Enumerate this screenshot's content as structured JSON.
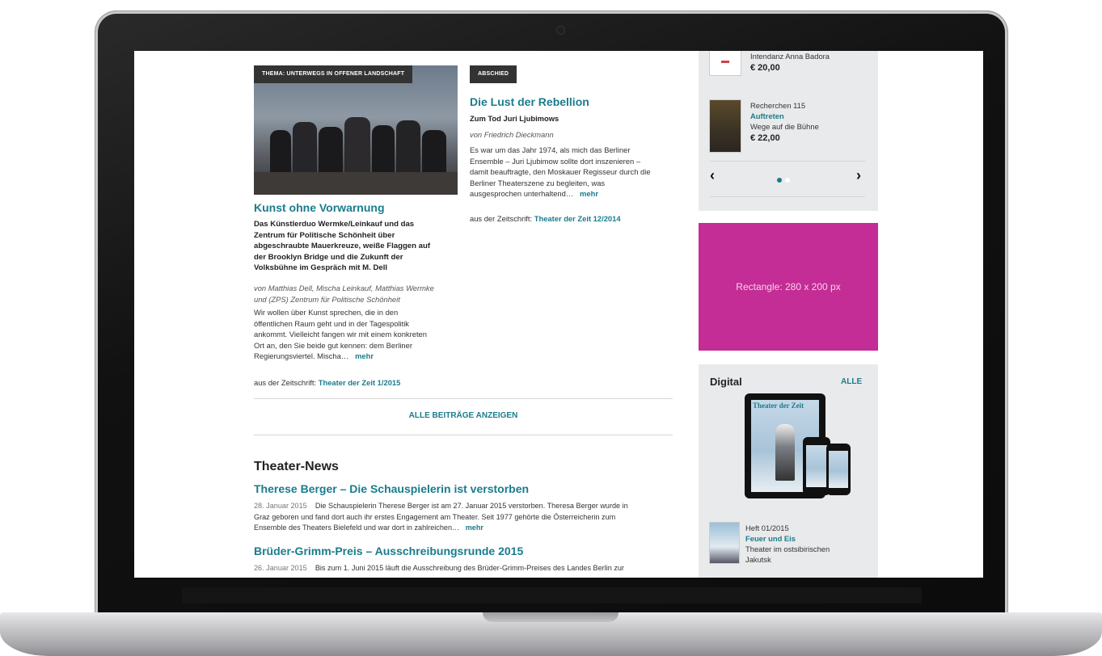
{
  "articles": [
    {
      "tag": "THEMA: UNTERWEGS IN OFFENER LANDSCHAFT",
      "title": "Kunst ohne Vorwarnung",
      "subtitle_lines": [
        "Das Künstlerduo Wermke/Leinkauf und das",
        "Zentrum für Politische Schönheit über",
        "abgeschraubte Mauerkreuze, weiße Flaggen auf",
        "der Brooklyn Bridge und die Zukunft der",
        "Volksbühne im Gespräch mit M. Dell"
      ],
      "author_lines": [
        "von Matthias Dell, Mischa Leinkauf, Matthias Wermke",
        "und (ZPS) Zentrum für Politische Schönheit"
      ],
      "body_lines": [
        "Wir wollen über Kunst sprechen, die in den",
        "öffentlichen Raum geht und in der Tagespolitik",
        "ankommt. Vielleicht fangen wir mit einem konkreten",
        "Ort an, den Sie beide gut kennen: dem Berliner",
        "Regierungsviertel. Mischa…"
      ],
      "more": "mehr",
      "source_prefix": "aus der Zeitschrift:",
      "source": "Theater der Zeit 1/2015"
    },
    {
      "tag": "ABSCHIED",
      "title": "Die Lust der Rebellion",
      "subtitle": "Zum Tod Juri Ljubimows",
      "author": "von Friedrich Dieckmann",
      "body_lines": [
        "Es war um das Jahr 1974, als mich das Berliner",
        "Ensemble – Juri Ljubimow sollte dort inszenieren –",
        "damit beauftragte, den Moskauer Regisseur durch die",
        "Berliner Theaterszene zu begleiten, was",
        "ausgesprochen unterhaltend…"
      ],
      "more": "mehr",
      "source_prefix": "aus der Zeitschrift:",
      "source": "Theater der Zeit 12/2014"
    }
  ],
  "all_posts_label": "ALLE BEITRÄGE ANZEIGEN",
  "news": {
    "heading": "Theater-News",
    "items": [
      {
        "title": "Therese Berger – Die Schauspielerin ist verstorben",
        "date": "28. Januar 2015",
        "lines": [
          "Die Schauspielerin Therese Berger ist am 27. Januar 2015 verstorben. Theresa Berger wurde in",
          "Graz geboren und fand dort auch ihr erstes Engagement am Theater. Seit 1977 gehörte die Österreicherin zum",
          "Ensemble des Theaters Bielefeld und war dort in zahlreichen…"
        ],
        "more": "mehr"
      },
      {
        "title": "Brüder-Grimm-Preis – Ausschreibungsrunde 2015",
        "date": "26. Januar 2015",
        "lines": [
          "Bis zum 1. Juni 2015 läuft die Ausschreibung des Brüder-Grimm-Preises des Landes Berlin zur"
        ]
      }
    ]
  },
  "sidebar": {
    "book1": {
      "line1": "Intendanz Anna Badora",
      "price": "€ 20,00"
    },
    "book2": {
      "series": "Recherchen 115",
      "title": "Auftreten",
      "subtitle": "Wege auf die Bühne",
      "price": "€ 22,00"
    },
    "carousel": {
      "prev": "‹",
      "next": "›",
      "pages": 2,
      "active": 1
    },
    "ad_label": "Rectangle: 280 x 200 px",
    "digital": {
      "heading": "Digital",
      "all": "ALLE",
      "magazine_title": "Theater der Zeit",
      "issue": "Heft 01/2015",
      "issue_title": "Feuer und Eis",
      "issue_line1": "Theater im ostsibirischen",
      "issue_line2": "Jakutsk"
    }
  }
}
